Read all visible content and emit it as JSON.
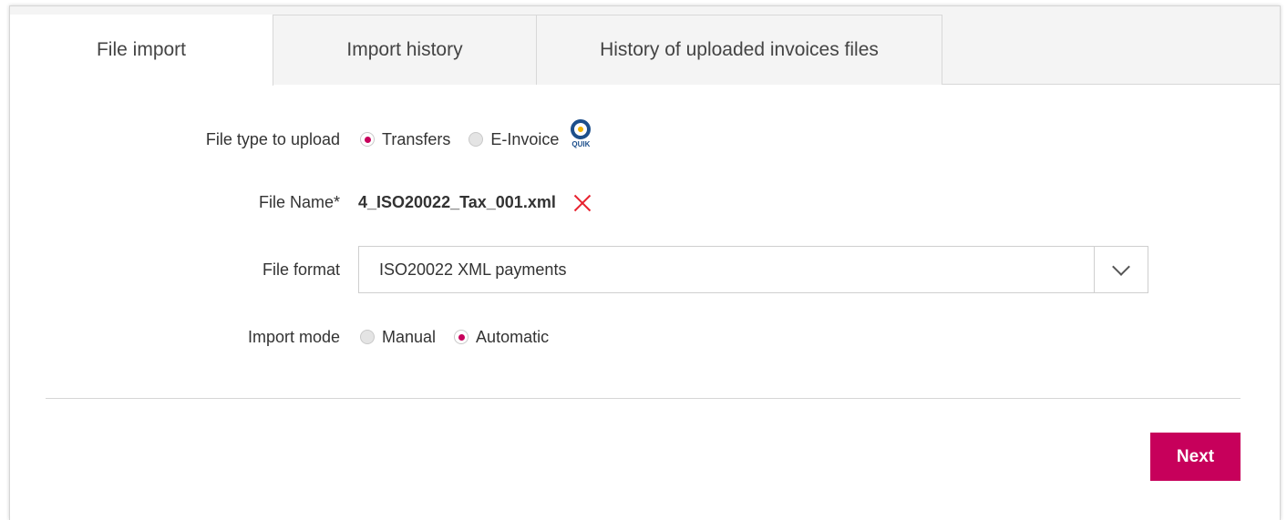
{
  "tabs": [
    {
      "label": "File import",
      "active": true
    },
    {
      "label": "Import history",
      "active": false
    },
    {
      "label": "History of uploaded invoices files",
      "active": false
    }
  ],
  "file_type": {
    "label": "File type to upload",
    "options": [
      {
        "label": "Transfers",
        "checked": true
      },
      {
        "label": "E-Invoice",
        "checked": false
      }
    ],
    "logo_text": "QUIK"
  },
  "file_name": {
    "label": "File Name*",
    "value": "4_ISO20022_Tax_001.xml"
  },
  "file_format": {
    "label": "File format",
    "selected": "ISO20022 XML payments"
  },
  "import_mode": {
    "label": "Import mode",
    "options": [
      {
        "label": "Manual",
        "checked": false
      },
      {
        "label": "Automatic",
        "checked": true
      }
    ]
  },
  "actions": {
    "next_label": "Next"
  },
  "colors": {
    "accent": "#c7005b",
    "remove": "#e8212e",
    "logo_blue": "#1d4f8b",
    "logo_yellow": "#f0b400"
  }
}
